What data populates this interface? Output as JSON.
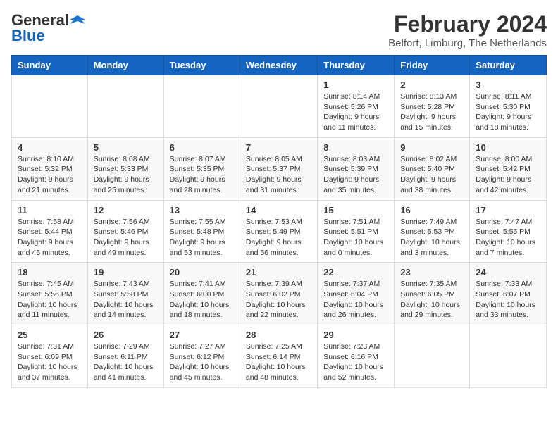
{
  "logo": {
    "general": "General",
    "blue": "Blue"
  },
  "title": "February 2024",
  "location": "Belfort, Limburg, The Netherlands",
  "weekdays": [
    "Sunday",
    "Monday",
    "Tuesday",
    "Wednesday",
    "Thursday",
    "Friday",
    "Saturday"
  ],
  "weeks": [
    [
      {
        "day": "",
        "info": ""
      },
      {
        "day": "",
        "info": ""
      },
      {
        "day": "",
        "info": ""
      },
      {
        "day": "",
        "info": ""
      },
      {
        "day": "1",
        "info": "Sunrise: 8:14 AM\nSunset: 5:26 PM\nDaylight: 9 hours\nand 11 minutes."
      },
      {
        "day": "2",
        "info": "Sunrise: 8:13 AM\nSunset: 5:28 PM\nDaylight: 9 hours\nand 15 minutes."
      },
      {
        "day": "3",
        "info": "Sunrise: 8:11 AM\nSunset: 5:30 PM\nDaylight: 9 hours\nand 18 minutes."
      }
    ],
    [
      {
        "day": "4",
        "info": "Sunrise: 8:10 AM\nSunset: 5:32 PM\nDaylight: 9 hours\nand 21 minutes."
      },
      {
        "day": "5",
        "info": "Sunrise: 8:08 AM\nSunset: 5:33 PM\nDaylight: 9 hours\nand 25 minutes."
      },
      {
        "day": "6",
        "info": "Sunrise: 8:07 AM\nSunset: 5:35 PM\nDaylight: 9 hours\nand 28 minutes."
      },
      {
        "day": "7",
        "info": "Sunrise: 8:05 AM\nSunset: 5:37 PM\nDaylight: 9 hours\nand 31 minutes."
      },
      {
        "day": "8",
        "info": "Sunrise: 8:03 AM\nSunset: 5:39 PM\nDaylight: 9 hours\nand 35 minutes."
      },
      {
        "day": "9",
        "info": "Sunrise: 8:02 AM\nSunset: 5:40 PM\nDaylight: 9 hours\nand 38 minutes."
      },
      {
        "day": "10",
        "info": "Sunrise: 8:00 AM\nSunset: 5:42 PM\nDaylight: 9 hours\nand 42 minutes."
      }
    ],
    [
      {
        "day": "11",
        "info": "Sunrise: 7:58 AM\nSunset: 5:44 PM\nDaylight: 9 hours\nand 45 minutes."
      },
      {
        "day": "12",
        "info": "Sunrise: 7:56 AM\nSunset: 5:46 PM\nDaylight: 9 hours\nand 49 minutes."
      },
      {
        "day": "13",
        "info": "Sunrise: 7:55 AM\nSunset: 5:48 PM\nDaylight: 9 hours\nand 53 minutes."
      },
      {
        "day": "14",
        "info": "Sunrise: 7:53 AM\nSunset: 5:49 PM\nDaylight: 9 hours\nand 56 minutes."
      },
      {
        "day": "15",
        "info": "Sunrise: 7:51 AM\nSunset: 5:51 PM\nDaylight: 10 hours\nand 0 minutes."
      },
      {
        "day": "16",
        "info": "Sunrise: 7:49 AM\nSunset: 5:53 PM\nDaylight: 10 hours\nand 3 minutes."
      },
      {
        "day": "17",
        "info": "Sunrise: 7:47 AM\nSunset: 5:55 PM\nDaylight: 10 hours\nand 7 minutes."
      }
    ],
    [
      {
        "day": "18",
        "info": "Sunrise: 7:45 AM\nSunset: 5:56 PM\nDaylight: 10 hours\nand 11 minutes."
      },
      {
        "day": "19",
        "info": "Sunrise: 7:43 AM\nSunset: 5:58 PM\nDaylight: 10 hours\nand 14 minutes."
      },
      {
        "day": "20",
        "info": "Sunrise: 7:41 AM\nSunset: 6:00 PM\nDaylight: 10 hours\nand 18 minutes."
      },
      {
        "day": "21",
        "info": "Sunrise: 7:39 AM\nSunset: 6:02 PM\nDaylight: 10 hours\nand 22 minutes."
      },
      {
        "day": "22",
        "info": "Sunrise: 7:37 AM\nSunset: 6:04 PM\nDaylight: 10 hours\nand 26 minutes."
      },
      {
        "day": "23",
        "info": "Sunrise: 7:35 AM\nSunset: 6:05 PM\nDaylight: 10 hours\nand 29 minutes."
      },
      {
        "day": "24",
        "info": "Sunrise: 7:33 AM\nSunset: 6:07 PM\nDaylight: 10 hours\nand 33 minutes."
      }
    ],
    [
      {
        "day": "25",
        "info": "Sunrise: 7:31 AM\nSunset: 6:09 PM\nDaylight: 10 hours\nand 37 minutes."
      },
      {
        "day": "26",
        "info": "Sunrise: 7:29 AM\nSunset: 6:11 PM\nDaylight: 10 hours\nand 41 minutes."
      },
      {
        "day": "27",
        "info": "Sunrise: 7:27 AM\nSunset: 6:12 PM\nDaylight: 10 hours\nand 45 minutes."
      },
      {
        "day": "28",
        "info": "Sunrise: 7:25 AM\nSunset: 6:14 PM\nDaylight: 10 hours\nand 48 minutes."
      },
      {
        "day": "29",
        "info": "Sunrise: 7:23 AM\nSunset: 6:16 PM\nDaylight: 10 hours\nand 52 minutes."
      },
      {
        "day": "",
        "info": ""
      },
      {
        "day": "",
        "info": ""
      }
    ]
  ]
}
